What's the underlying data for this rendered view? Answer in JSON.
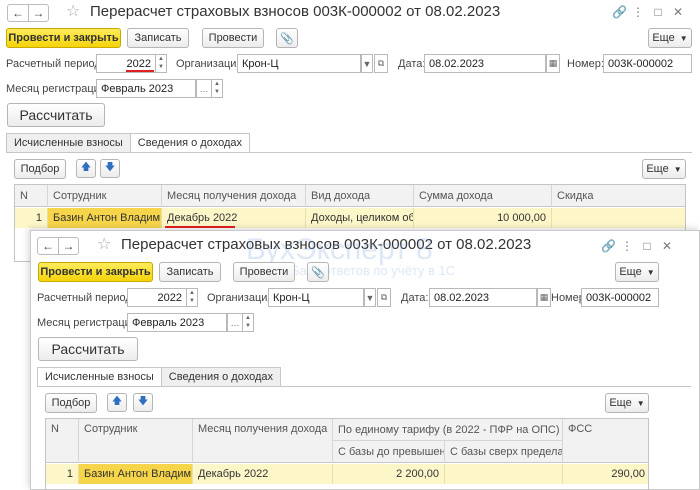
{
  "window1": {
    "title": "Перерасчет страховых взносов 003К-000002 от 08.02.2023",
    "toolbar": {
      "post_close": "Провести и закрыть",
      "save": "Записать",
      "post": "Провести",
      "more": "Еще"
    },
    "fields": {
      "period_label": "Расчетный период:",
      "period_value": "2022",
      "org_label": "Организация:",
      "org_value": "Крон-Ц",
      "date_label": "Дата:",
      "date_value": "08.02.2023",
      "number_label": "Номер:",
      "number_value": "003К-000002",
      "reg_month_label": "Месяц регистрации:",
      "reg_month_value": "Февраль 2023"
    },
    "calc_button": "Рассчитать",
    "tabs": [
      "Исчисленные взносы",
      "Сведения о доходах"
    ],
    "grid_toolbar": {
      "select": "Подбор",
      "more": "Еще"
    },
    "table": {
      "columns": [
        "N",
        "Сотрудник",
        "Месяц получения дохода",
        "Вид дохода",
        "Сумма дохода",
        "Скидка"
      ],
      "rows": [
        [
          "1",
          "Базин Антон Владим…",
          "Декабрь 2022",
          "Доходы, целиком об…",
          "10 000,00",
          ""
        ]
      ]
    }
  },
  "window2": {
    "title": "Перерасчет страховых взносов 003К-000002 от 08.02.2023",
    "toolbar": {
      "post_close": "Провести и закрыть",
      "save": "Записать",
      "post": "Провести",
      "more": "Еще"
    },
    "fields": {
      "period_label": "Расчетный период:",
      "period_value": "2022",
      "org_label": "Организация:",
      "org_value": "Крон-Ц",
      "date_label": "Дата:",
      "date_value": "08.02.2023",
      "number_label": "Номер:",
      "number_value": "003К-000002",
      "reg_month_label": "Месяц регистрации:",
      "reg_month_value": "Февраль 2023"
    },
    "calc_button": "Рассчитать",
    "tabs": [
      "Исчисленные взносы",
      "Сведения о доходах"
    ],
    "grid_toolbar": {
      "select": "Подбор",
      "more": "Еще"
    },
    "table": {
      "columns": [
        "N",
        "Сотрудник",
        "Месяц получения дохода",
        "По единому тарифу (в 2022 - ПФР на ОПС)",
        "ФСС"
      ],
      "subcolumns": [
        "С базы до превышения",
        "С базы сверх предела"
      ],
      "rows": [
        [
          "1",
          "Базин Антон Владим…",
          "Декабрь 2022",
          "2 200,00",
          "",
          "290,00"
        ]
      ]
    }
  },
  "watermark": {
    "brand": "БухЭксперт 8",
    "tagline": "База ответов по учёту в 1С"
  },
  "colors": {
    "primary_button": "#f5d30a",
    "selected_row": "#fdf6c8",
    "annotation": "#e02020",
    "arrow": "#2f6fbf"
  }
}
